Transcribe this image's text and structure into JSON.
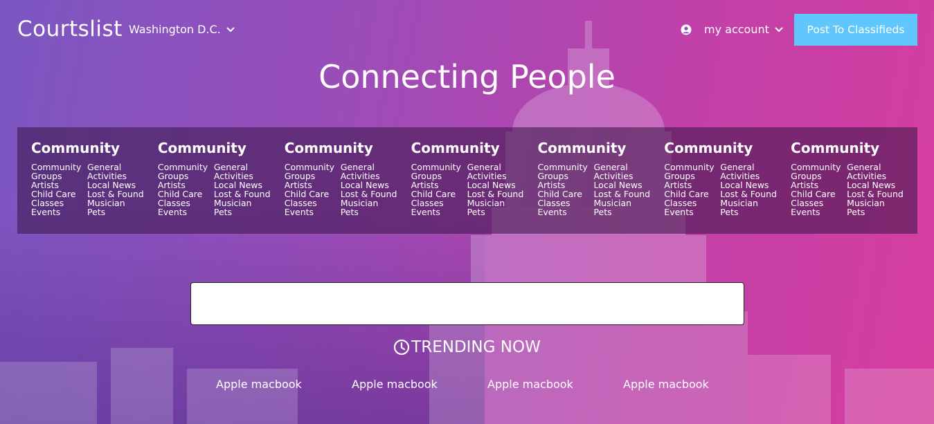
{
  "header": {
    "brand": "Courtslist",
    "city": "Washington D.C.",
    "account_label": "my account",
    "post_button": "Post To Classifieds"
  },
  "hero": {
    "title": "Connecting People"
  },
  "categories": [
    {
      "heading": "Community",
      "left": [
        "Community",
        "Groups",
        "Artists",
        "Child Care",
        "Classes",
        "Events"
      ],
      "right": [
        "General",
        "Activities",
        "Local News",
        "Lost & Found",
        "Musician",
        "Pets"
      ]
    },
    {
      "heading": "Community",
      "left": [
        "Community",
        "Groups",
        "Artists",
        "Child Care",
        "Classes",
        "Events"
      ],
      "right": [
        "General",
        "Activities",
        "Local News",
        "Lost & Found",
        "Musician",
        "Pets"
      ]
    },
    {
      "heading": "Community",
      "left": [
        "Community",
        "Groups",
        "Artists",
        "Child Care",
        "Classes",
        "Events"
      ],
      "right": [
        "General",
        "Activities",
        "Local News",
        "Lost & Found",
        "Musician",
        "Pets"
      ]
    },
    {
      "heading": "Community",
      "left": [
        "Community",
        "Groups",
        "Artists",
        "Child Care",
        "Classes",
        "Events"
      ],
      "right": [
        "General",
        "Activities",
        "Local News",
        "Lost & Found",
        "Musician",
        "Pets"
      ]
    },
    {
      "heading": "Community",
      "left": [
        "Community",
        "Groups",
        "Artists",
        "Child Care",
        "Classes",
        "Events"
      ],
      "right": [
        "General",
        "Activities",
        "Local News",
        "Lost & Found",
        "Musician",
        "Pets"
      ]
    },
    {
      "heading": "Community",
      "left": [
        "Community",
        "Groups",
        "Artists",
        "Child Care",
        "Classes",
        "Events"
      ],
      "right": [
        "General",
        "Activities",
        "Local News",
        "Lost & Found",
        "Musician",
        "Pets"
      ]
    },
    {
      "heading": "Community",
      "left": [
        "Community",
        "Groups",
        "Artists",
        "Child Care",
        "Classes",
        "Events"
      ],
      "right": [
        "General",
        "Activities",
        "Local News",
        "Lost & Found",
        "Musician",
        "Pets"
      ]
    }
  ],
  "search": {
    "value": "",
    "placeholder": ""
  },
  "trending": {
    "label": "TRENDING NOW",
    "items": [
      "Apple macbook",
      "Apple macbook",
      "Apple macbook",
      "Apple macbook"
    ]
  },
  "colors": {
    "post_button": "#5fc7fb",
    "gradient_start": "#7b57c2",
    "gradient_end": "#d73e9f"
  },
  "icons": {
    "city_dropdown": "chevron-down-icon",
    "account": "user-circle-icon",
    "account_dropdown": "chevron-down-icon",
    "trending": "clock-icon"
  }
}
